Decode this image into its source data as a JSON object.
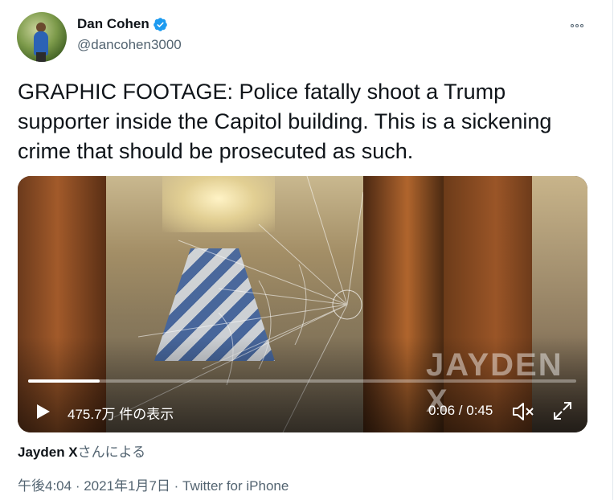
{
  "author": {
    "display_name": "Dan Cohen",
    "handle": "@dancohen3000"
  },
  "tweet": {
    "text": "GRAPHIC FOOTAGE: Police fatally shoot a Trump\nsupporter inside the Capitol building. This is a sickening\ncrime that should be prosecuted as such."
  },
  "video": {
    "watermark": "JAYDEN X",
    "views": "475.7万 件の表示",
    "time": "0:06 / 0:45",
    "progress_fraction": 0.13
  },
  "attribution": {
    "name": "Jayden X",
    "suffix": "さんによる"
  },
  "meta": {
    "time": "午後4:04",
    "date": "2021年1月7日",
    "source": "Twitter for iPhone",
    "separator": " · "
  },
  "colors": {
    "verified_blue": "#1d9bf0",
    "secondary_text": "#536471",
    "primary_text": "#0f1419"
  },
  "icons": {
    "verified": "verified-badge-icon",
    "more": "more-options-icon",
    "play": "play-icon",
    "mute": "muted-speaker-icon",
    "fullscreen": "fullscreen-expand-icon"
  }
}
